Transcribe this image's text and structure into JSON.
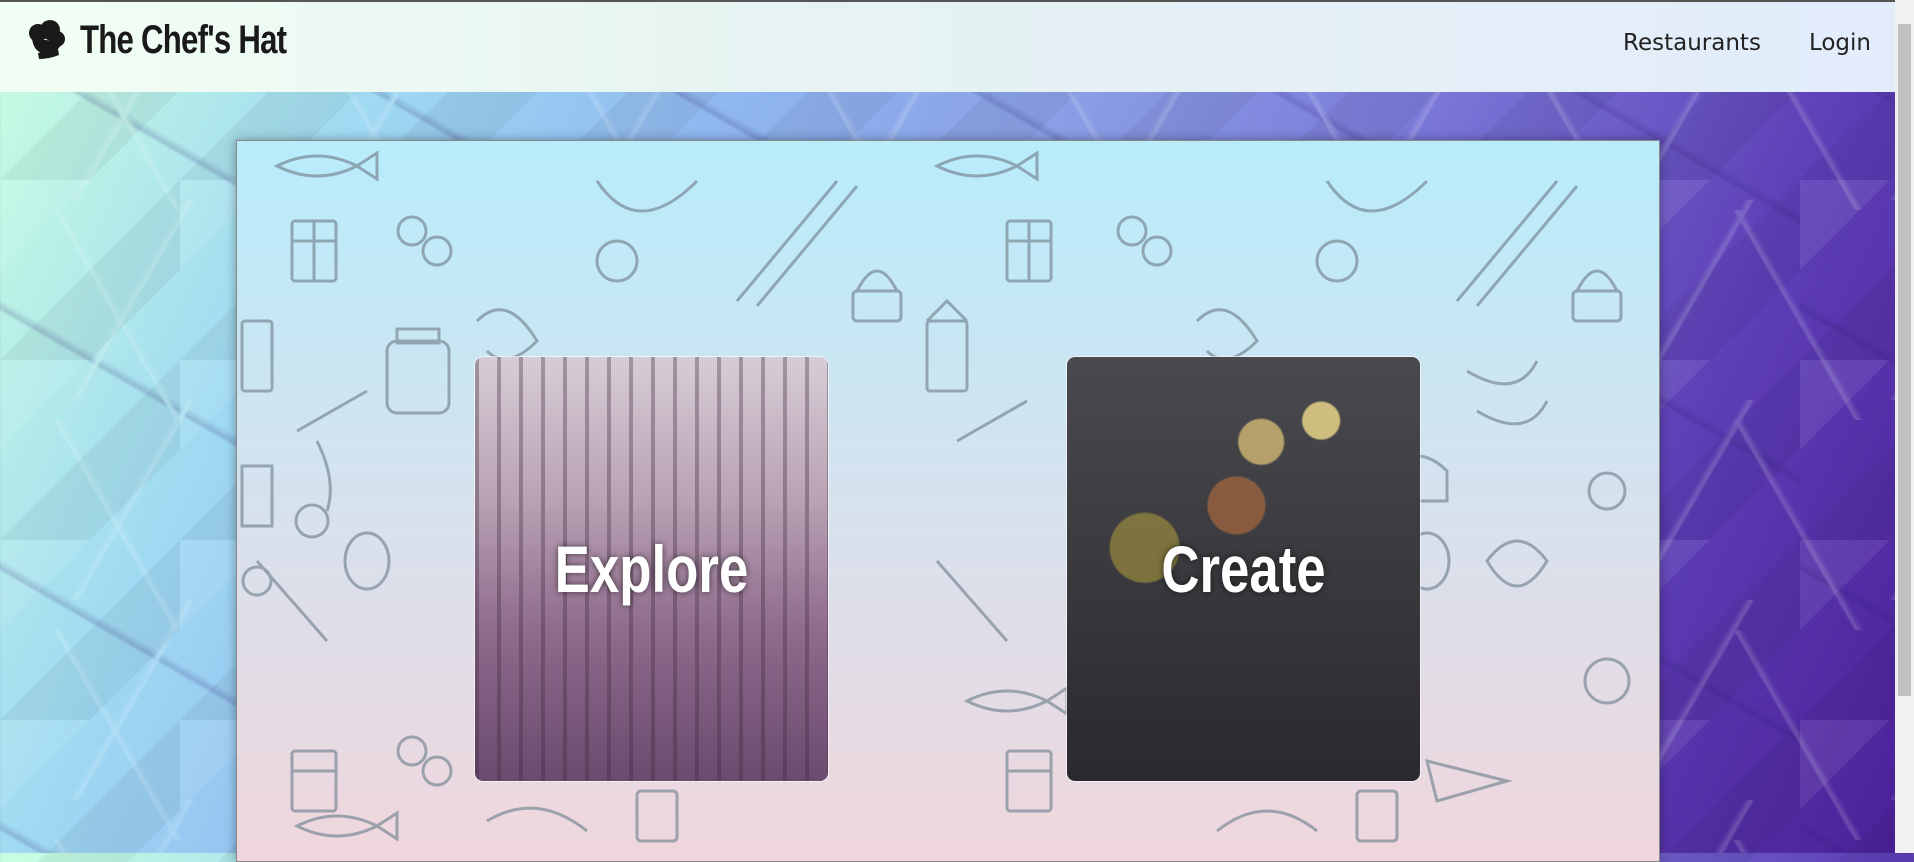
{
  "navbar": {
    "brand": "The Chef's Hat",
    "brand_icon": "chef-hat-icon",
    "links": [
      "Restaurants",
      "Login"
    ]
  },
  "hero": {
    "pattern": "food-doodle-pattern",
    "cards": [
      {
        "label": "Explore",
        "image": "restaurant-bar-image"
      },
      {
        "label": "Create",
        "image": "spices-ingredients-image"
      }
    ]
  }
}
